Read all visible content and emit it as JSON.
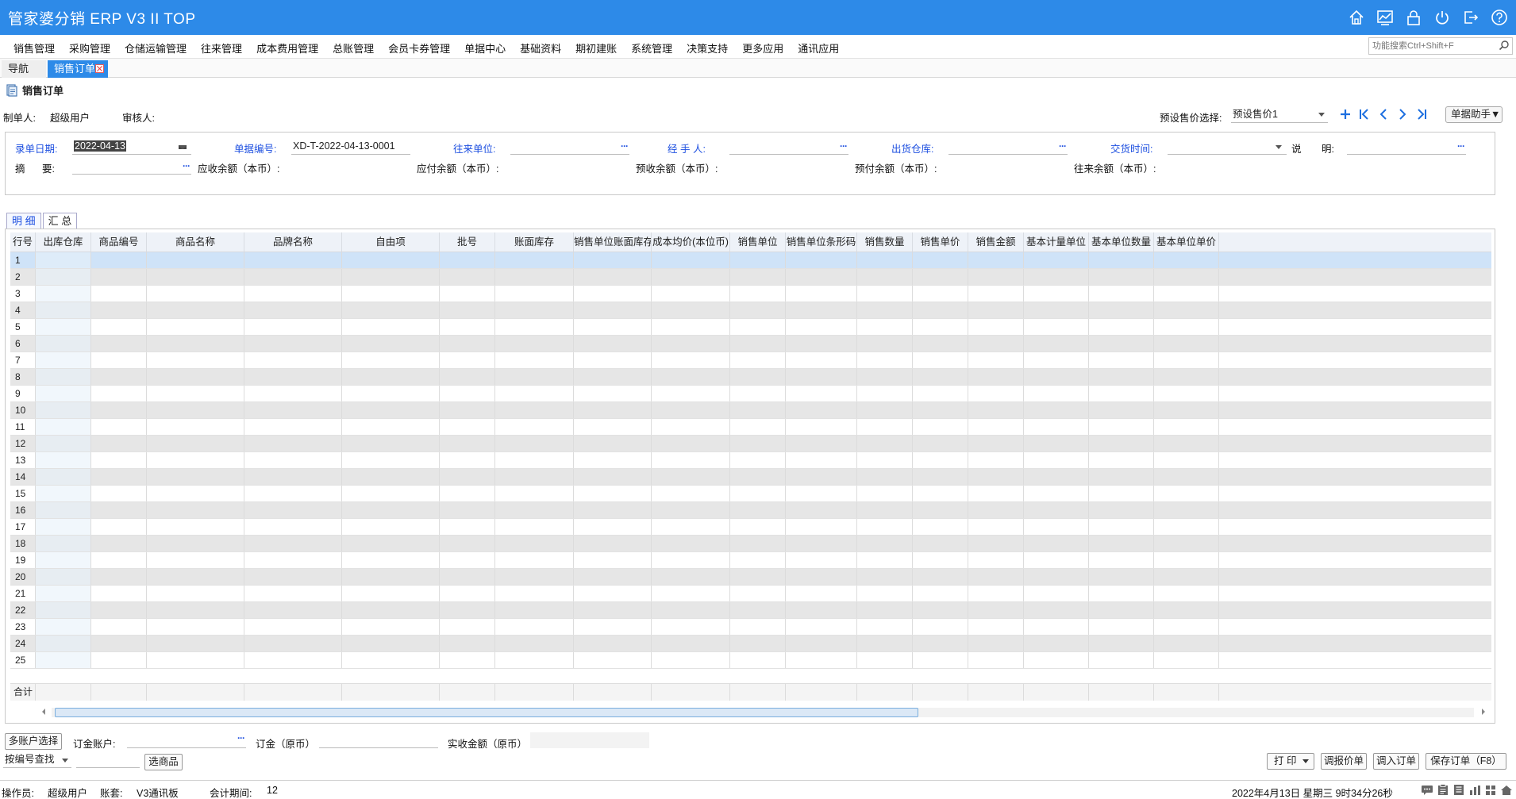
{
  "app": {
    "title": "管家婆分销 ERP V3 II TOP"
  },
  "colors": {
    "brand": "#2d8ae8",
    "field_label_blue": "#1d4fe0",
    "row_alt": "#e6e6e6",
    "row_selected": "#cfe3f8"
  },
  "titlebar_icons": [
    "home-icon",
    "chart-icon",
    "lock-icon",
    "power-icon",
    "exit-icon",
    "help-icon"
  ],
  "menu": {
    "items": [
      "销售管理",
      "采购管理",
      "仓储运输管理",
      "往来管理",
      "成本费用管理",
      "总账管理",
      "会员卡券管理",
      "单据中心",
      "基础资料",
      "期初建账",
      "系统管理",
      "决策支持",
      "更多应用",
      "通讯应用"
    ],
    "search_placeholder": "功能搜索Ctrl+Shift+F"
  },
  "page_tabs": {
    "nav": "导航",
    "active": "销售订单"
  },
  "doc": {
    "title": "销售订单",
    "creator_label": "制单人:",
    "creator": "超级用户",
    "reviewer_label": "审核人:",
    "reviewer": "",
    "preset_label": "预设售价选择:",
    "preset_value": "预设售价1",
    "assist_button": "单据助手▼"
  },
  "form": {
    "date_label": "录单日期:",
    "date_value": "2022-04-13",
    "doc_no_label": "单据编号:",
    "doc_no_value": "XD-T-2022-04-13-0001",
    "partner_label": "往来单位:",
    "partner_value": "",
    "handler_label": "经  手  人:",
    "handler_value": "",
    "warehouse_label": "出货仓库:",
    "warehouse_value": "",
    "trade_time_label": "交货时间:",
    "trade_time_value": "",
    "note_label_1": "说",
    "note_label_2": "明:",
    "note_value": "",
    "summary_label_1": "摘",
    "summary_label_2": "要:",
    "summary_value": "",
    "receivable_label": "应收余额（本币）:",
    "payable_label": "应付余额（本币）:",
    "prereceive_label": "预收余额（本币）:",
    "prepay_label": "预付余额（本币）:",
    "balance_label": "往来余额（本币）:"
  },
  "detail_tabs": [
    "明 细",
    "汇 总"
  ],
  "grid": {
    "columns": [
      "行号",
      "出库仓库",
      "商品编号",
      "商品名称",
      "品牌名称",
      "自由项",
      "批号",
      "账面库存",
      "销售单位账面库存",
      "成本均价(本位币)",
      "销售单位",
      "销售单位条形码",
      "销售数量",
      "销售单价",
      "销售金额",
      "基本计量单位",
      "基本单位数量",
      "基本单位单价"
    ],
    "rows": [
      "1",
      "2",
      "3",
      "4",
      "5",
      "6",
      "7",
      "8",
      "9",
      "10",
      "11",
      "12",
      "13",
      "14",
      "15",
      "16",
      "17",
      "18",
      "19",
      "20",
      "21",
      "22",
      "23",
      "24",
      "25"
    ],
    "total_label": "合计"
  },
  "bottom": {
    "multi_account_button": "多账户选择",
    "deposit_account_label": "订金账户:",
    "deposit_label": "订金（原币）",
    "received_label": "实收金额（原币）",
    "search_mode": "按编号查找",
    "select_goods_button": "选商品",
    "print_button": "打  印",
    "price_report_button": "调报价单",
    "import_order_button": "调入订单",
    "save_button": "保存订单（F8）"
  },
  "status": {
    "operator_label": "操作员:",
    "operator": "超级用户",
    "account_label": "账套:",
    "account": "V3通讯板",
    "period_label": "会计期间:",
    "period": "12",
    "datetime": "2022年4月13日  星期三  9时34分26秒"
  }
}
